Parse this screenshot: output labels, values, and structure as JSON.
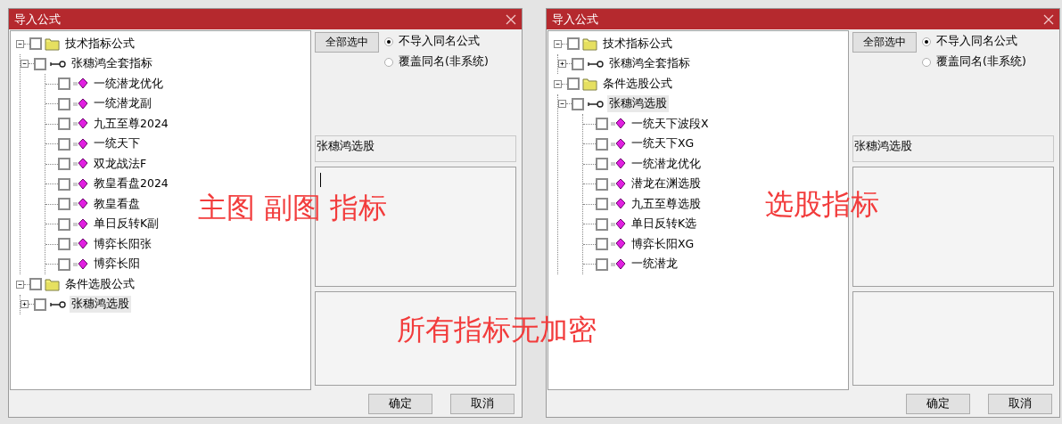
{
  "dialogs": [
    {
      "title": "导入公式",
      "tree": [
        {
          "kind": "folder",
          "label": "技术指标公式",
          "checked": false,
          "expanded": true,
          "selected": false,
          "children": [
            {
              "kind": "group",
              "label": "张穗鸿全套指标",
              "checked": false,
              "expanded": true,
              "selected": false,
              "children": [
                {
                  "kind": "formula",
                  "label": "一统潜龙优化",
                  "checked": false,
                  "selected": false
                },
                {
                  "kind": "formula",
                  "label": "一统潜龙副",
                  "checked": false,
                  "selected": false
                },
                {
                  "kind": "formula",
                  "label": "九五至尊2024",
                  "checked": false,
                  "selected": false
                },
                {
                  "kind": "formula",
                  "label": "一统天下",
                  "checked": false,
                  "selected": false
                },
                {
                  "kind": "formula",
                  "label": "双龙战法F",
                  "checked": false,
                  "selected": false
                },
                {
                  "kind": "formula",
                  "label": "教皇看盘2024",
                  "checked": false,
                  "selected": false
                },
                {
                  "kind": "formula",
                  "label": "教皇看盘",
                  "checked": false,
                  "selected": false
                },
                {
                  "kind": "formula",
                  "label": "单日反转K副",
                  "checked": false,
                  "selected": false
                },
                {
                  "kind": "formula",
                  "label": "博弈长阳张",
                  "checked": false,
                  "selected": false
                },
                {
                  "kind": "formula",
                  "label": "博弈长阳",
                  "checked": false,
                  "selected": false
                }
              ]
            }
          ]
        },
        {
          "kind": "folder",
          "label": "条件选股公式",
          "checked": false,
          "expanded": true,
          "selected": false,
          "children": [
            {
              "kind": "group",
              "label": "张穗鸿选股",
              "checked": false,
              "expanded": false,
              "selected": true
            }
          ]
        }
      ],
      "select_all_button": "全部选中",
      "options": [
        {
          "label": "不导入同名公式",
          "selected": true
        },
        {
          "label": "覆盖同名(非系统)",
          "selected": false
        }
      ],
      "formula_name": "张穗鸿选股",
      "text_cursor": true,
      "buttons": [
        "确定",
        "取消"
      ]
    },
    {
      "title": "导入公式",
      "tree": [
        {
          "kind": "folder",
          "label": "技术指标公式",
          "checked": false,
          "expanded": true,
          "selected": false,
          "children": [
            {
              "kind": "group",
              "label": "张穗鸿全套指标",
              "checked": false,
              "expanded": false,
              "selected": false
            }
          ]
        },
        {
          "kind": "folder",
          "label": "条件选股公式",
          "checked": false,
          "expanded": true,
          "selected": false,
          "children": [
            {
              "kind": "group",
              "label": "张穗鸿选股",
              "checked": false,
              "expanded": true,
              "selected": true,
              "children": [
                {
                  "kind": "formula",
                  "label": "一统天下波段X",
                  "checked": false,
                  "selected": false
                },
                {
                  "kind": "formula",
                  "label": "一统天下XG",
                  "checked": false,
                  "selected": false
                },
                {
                  "kind": "formula",
                  "label": "一统潜龙优化",
                  "checked": false,
                  "selected": false
                },
                {
                  "kind": "formula",
                  "label": "潜龙在渊选股",
                  "checked": false,
                  "selected": false
                },
                {
                  "kind": "formula",
                  "label": "九五至尊选股",
                  "checked": false,
                  "selected": false
                },
                {
                  "kind": "formula",
                  "label": "单日反转K选",
                  "checked": false,
                  "selected": false
                },
                {
                  "kind": "formula",
                  "label": "博弈长阳XG",
                  "checked": false,
                  "selected": false
                },
                {
                  "kind": "formula",
                  "label": "一统潜龙",
                  "checked": false,
                  "selected": false
                }
              ]
            }
          ]
        }
      ],
      "select_all_button": "全部选中",
      "options": [
        {
          "label": "不导入同名公式",
          "selected": true
        },
        {
          "label": "覆盖同名(非系统)",
          "selected": false
        }
      ],
      "formula_name": "张穗鸿选股",
      "text_cursor": false,
      "buttons": [
        "确定",
        "取消"
      ]
    }
  ],
  "annotations": [
    "主图 副图 指标",
    "选股指标",
    "所有指标无加密"
  ]
}
